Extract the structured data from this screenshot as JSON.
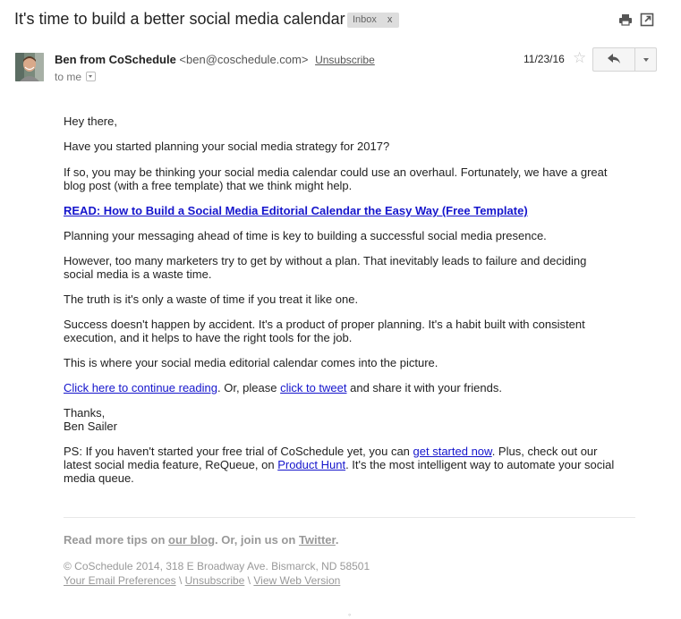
{
  "subject": "It's time to build a better social media calendar",
  "label": {
    "name": "Inbox",
    "remove": "x"
  },
  "header_icons": [
    "print-icon",
    "open-in-new-window-icon"
  ],
  "sender": {
    "name": "Ben from CoSchedule",
    "email": "<ben@coschedule.com>",
    "unsubscribe": "Unsubscribe",
    "to": "to me"
  },
  "date": "11/23/16",
  "star": "☆",
  "body": {
    "greeting": "Hey there,",
    "p1": "Have you started planning your social media strategy for 2017?",
    "p2_line1": "If so, you may be thinking your social media calendar could use an overhaul. Fortunately, we have a great",
    "p2_line2": "blog post (with a free template) that we think might help.",
    "read_link": "READ: How to Build a Social Media Editorial Calendar the Easy Way (Free Template)",
    "p3": "Planning your messaging ahead of time is key to building a successful social media presence.",
    "p4_line1": "However, too many marketers try to get by without a plan. That inevitably leads to failure and deciding",
    "p4_line2": "social media is a waste time.",
    "p5": "The truth is it's only a waste of time if you treat it like one.",
    "p6_line1": "Success doesn't happen by accident. It's a product of proper planning. It's a habit built with consistent",
    "p6_line2": "execution, and it helps to have the right tools for the job.",
    "p7": "This is where your social media editorial calendar comes into the picture.",
    "continue_link": "Click here to continue reading",
    "continue_mid": ". Or, please ",
    "tweet_link": "click to tweet",
    "continue_end": " and share it with your friends.",
    "thanks": "Thanks,",
    "signature": "Ben Sailer",
    "ps_start": "PS: If you haven't started your free trial of CoSchedule yet, you can ",
    "ps_link1": "get started now",
    "ps_mid": ". Plus, check out our",
    "ps_line2_start": "latest social media feature, ReQueue, on ",
    "ps_link2": "Product Hunt",
    "ps_line2_end": ". It's the most intelligent way to automate your social",
    "ps_line3": "media queue."
  },
  "footer": {
    "tips_start": "Read more tips on ",
    "blog_link": "our blog",
    "tips_mid": ". Or, join us on ",
    "twitter_link": "Twitter",
    "tips_end": ".",
    "copyright": "© CoSchedule 2014, 318 E Broadway Ave. Bismarck, ND 58501",
    "prefs_link": "Your Email Preferences",
    "sep": " \\ ",
    "unsubscribe_link": "Unsubscribe",
    "web_link": "View Web Version"
  }
}
